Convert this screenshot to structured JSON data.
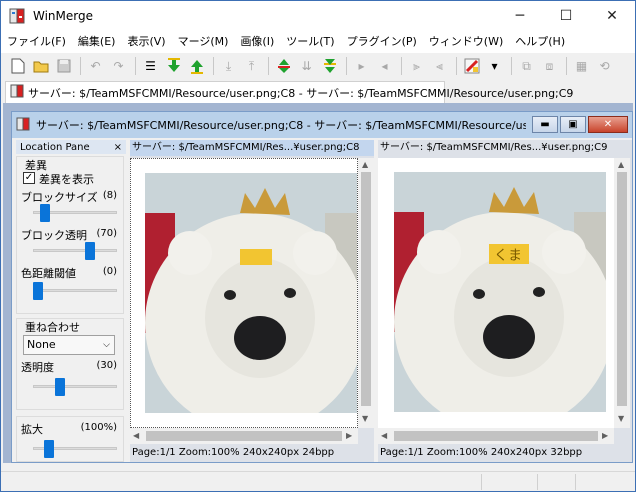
{
  "window": {
    "title": "WinMerge",
    "minimize": "─",
    "maximize": "☐",
    "close": "✕"
  },
  "menu": [
    "ファイル(F)",
    "編集(E)",
    "表示(V)",
    "マージ(M)",
    "画像(I)",
    "ツール(T)",
    "プラグイン(P)",
    "ウィンドウ(W)",
    "ヘルプ(H)"
  ],
  "doc_tab": {
    "label": "サーバー: $/TeamMSFCMMI/Resource/user.png;C8 - サーバー: $/TeamMSFCMMI/Resource/user.png;C9"
  },
  "child": {
    "title": "サーバー: $/TeamMSFCMMI/Resource/user.png;C8 - サーバー: $/TeamMSFCMMI/Resource/us..."
  },
  "location_pane": {
    "title": "Location Pane",
    "close": "×",
    "diff_group": "差異",
    "show_diff": "差異を表示",
    "block_size_label": "ブロックサイズ",
    "block_size_value": "(8)",
    "block_size_level": 0.1,
    "block_alpha_label": "ブロック透明",
    "block_alpha_value": "(70)",
    "block_alpha_level": 0.7,
    "color_threshold_label": "色距離閾値",
    "color_threshold_value": "(0)",
    "color_threshold_level": 0.0,
    "overlay_group": "重ね合わせ",
    "overlay_mode": "None",
    "overlay_alpha_label": "透明度",
    "overlay_alpha_value": "(30)",
    "overlay_alpha_level": 0.3,
    "zoom_label": "拡大",
    "zoom_value": "(100%)",
    "zoom_level": 0.15
  },
  "left_pane": {
    "header": "サーバー: $/TeamMSFCMMI/Res...¥user.png;C8",
    "status": "Page:1/1 Zoom:100% 240x240px 24bpp",
    "label_on_image": ""
  },
  "right_pane": {
    "header": "サーバー: $/TeamMSFCMMI/Res...¥user.png;C9",
    "status": "Page:1/1 Zoom:100% 240x240px 32bpp",
    "label_on_image": "くま"
  },
  "colors": {
    "accent": "#0a74d9",
    "title_active": "#b9d1ea",
    "mdi_bg": "#a3b5d1",
    "diff_block": "#f2c531"
  },
  "icons": [
    "new-icon",
    "open-icon",
    "save-icon",
    "undo-icon",
    "redo-icon",
    "options-icon",
    "next-diff-icon",
    "prev-diff-icon",
    "first-diff-icon",
    "last-diff-icon",
    "current-diff-icon",
    "copy-right-icon",
    "copy-left-icon",
    "copy-all-right-icon",
    "copy-all-left-icon",
    "colors-icon",
    "dropdown-icon",
    "expand-icon",
    "collapse-icon",
    "tile-icon",
    "refresh-icon"
  ]
}
